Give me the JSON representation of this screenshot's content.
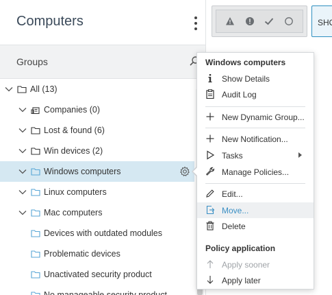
{
  "header": {
    "title": "Computers"
  },
  "groups_bar": {
    "label": "Groups"
  },
  "tree": {
    "items": [
      {
        "label": "All (13)",
        "level": 0,
        "expandable": true,
        "icon": "folder-outline-icon"
      },
      {
        "label": "Companies (0)",
        "level": 1,
        "expandable": true,
        "icon": "companies-icon"
      },
      {
        "label": "Lost & found (6)",
        "level": 1,
        "expandable": true,
        "icon": "folder-outline-icon"
      },
      {
        "label": "Win devices (2)",
        "level": 1,
        "expandable": true,
        "icon": "folder-outline-icon"
      },
      {
        "label": "Windows computers",
        "level": 1,
        "expandable": true,
        "icon": "folder-blue-icon",
        "selected": true
      },
      {
        "label": "Linux computers",
        "level": 1,
        "expandable": true,
        "icon": "folder-blue-icon"
      },
      {
        "label": "Mac computers",
        "level": 1,
        "expandable": true,
        "icon": "folder-blue-icon"
      },
      {
        "label": "Devices with outdated modules",
        "level": 2,
        "expandable": false,
        "icon": "folder-blue-icon"
      },
      {
        "label": "Problematic devices",
        "level": 2,
        "expandable": false,
        "icon": "folder-blue-icon"
      },
      {
        "label": "Unactivated security product",
        "level": 2,
        "expandable": false,
        "icon": "folder-blue-icon"
      },
      {
        "label": "No manageable security product",
        "level": 2,
        "expandable": false,
        "icon": "folder-blue-icon"
      }
    ]
  },
  "toolbar": {
    "show_label": "SHO"
  },
  "context_menu": {
    "section1_title": "Windows computers",
    "show_details": "Show Details",
    "audit_log": "Audit Log",
    "new_dynamic_group": "New Dynamic Group...",
    "new_notification": "New Notification...",
    "tasks": "Tasks",
    "manage_policies": "Manage Policies...",
    "edit": "Edit...",
    "move": "Move...",
    "delete": "Delete",
    "section2_title": "Policy application",
    "apply_sooner": "Apply sooner",
    "apply_later": "Apply later"
  },
  "colors": {
    "accent": "#3a8fc4",
    "selected_row": "#d5e8f2",
    "folder_blue": "#58a6d6"
  }
}
